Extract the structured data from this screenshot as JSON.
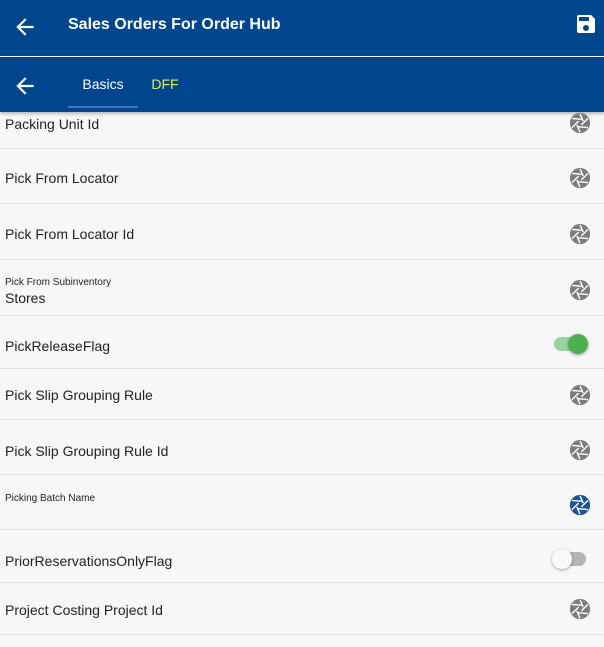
{
  "header": {
    "title": "Sales Orders For Order Hub"
  },
  "tabs": [
    {
      "label": "Basics"
    },
    {
      "label": "DFF"
    }
  ],
  "colors": {
    "appbar": "#00468f",
    "active_tab_text": "#ffffff",
    "inactive_tab_text": "#d7f261",
    "toggle_on": "#4caf50",
    "icon_gray": "#7d7d7d",
    "icon_blue": "#1a5599"
  },
  "rows": [
    {
      "label": "Packing Unit Id",
      "icon": "aperture-icon"
    },
    {
      "label": "Pick From Locator",
      "icon": "aperture-icon"
    },
    {
      "label": "Pick From Locator Id",
      "icon": "aperture-icon"
    },
    {
      "label": "Pick From Subinventory",
      "value": "Stores",
      "icon": "aperture-icon"
    },
    {
      "label": "PickReleaseFlag",
      "toggle": "on"
    },
    {
      "label": "Pick Slip Grouping Rule",
      "icon": "aperture-icon"
    },
    {
      "label": "Pick Slip Grouping Rule Id",
      "icon": "aperture-icon"
    },
    {
      "label": "Picking Batch Name",
      "icon": "aperture-icon",
      "icon_color": "blue"
    },
    {
      "label": "PriorReservationsOnlyFlag",
      "toggle": "off"
    },
    {
      "label": "Project Costing Project Id",
      "icon": "aperture-icon"
    }
  ]
}
